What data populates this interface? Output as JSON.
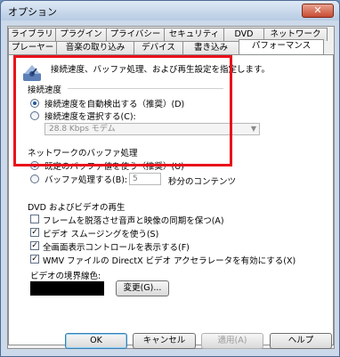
{
  "window": {
    "title": "オプション",
    "close_label": "✕"
  },
  "tabs": {
    "row1": [
      "ライブラリ",
      "プラグイン",
      "プライバシー",
      "セキュリティ",
      "DVD",
      "ネットワーク"
    ],
    "row2": [
      "プレーヤー",
      "音楽の取り込み",
      "デバイス",
      "書き込み",
      "パフォーマンス"
    ],
    "active": "パフォーマンス"
  },
  "header": {
    "icon": "performance-icon",
    "text": "接続速度、バッファ処理、および再生設定を指定します。"
  },
  "connection": {
    "title": "接続速度",
    "auto_label": "接続速度を自動検出する（推奨）(D)",
    "manual_label": "接続速度を選択する(C):",
    "speed_select": "28.8 Kbps モデム",
    "selected": "auto"
  },
  "buffer": {
    "title": "ネットワークのバッファ処理",
    "default_label": "既定のバッファ値を使う（推奨）(U)",
    "custom_label": "バッファ処理する(B):",
    "seconds_value": "5",
    "seconds_suffix": "秒分のコンテンツ",
    "selected": "default"
  },
  "dvd": {
    "title": "DVD およびビデオの再生",
    "options": [
      {
        "label": "フレームを脱落させ音声と映像の同期を保つ(A)",
        "checked": false
      },
      {
        "label": "ビデオ スムージングを使う(S)",
        "checked": true
      },
      {
        "label": "全画面表示コントロールを表示する(F)",
        "checked": true
      },
      {
        "label": "WMV ファイルの DirectX ビデオ アクセラレータを有効にする(X)",
        "checked": true
      }
    ],
    "border_color_label": "ビデオの境界線色:",
    "border_color": "#000000",
    "change_button": "変更(G)..."
  },
  "buttons": {
    "ok": "OK",
    "cancel": "キャンセル",
    "apply": "適用(A)",
    "help": "ヘルプ"
  },
  "colors": {
    "highlight": "#e8111a"
  }
}
